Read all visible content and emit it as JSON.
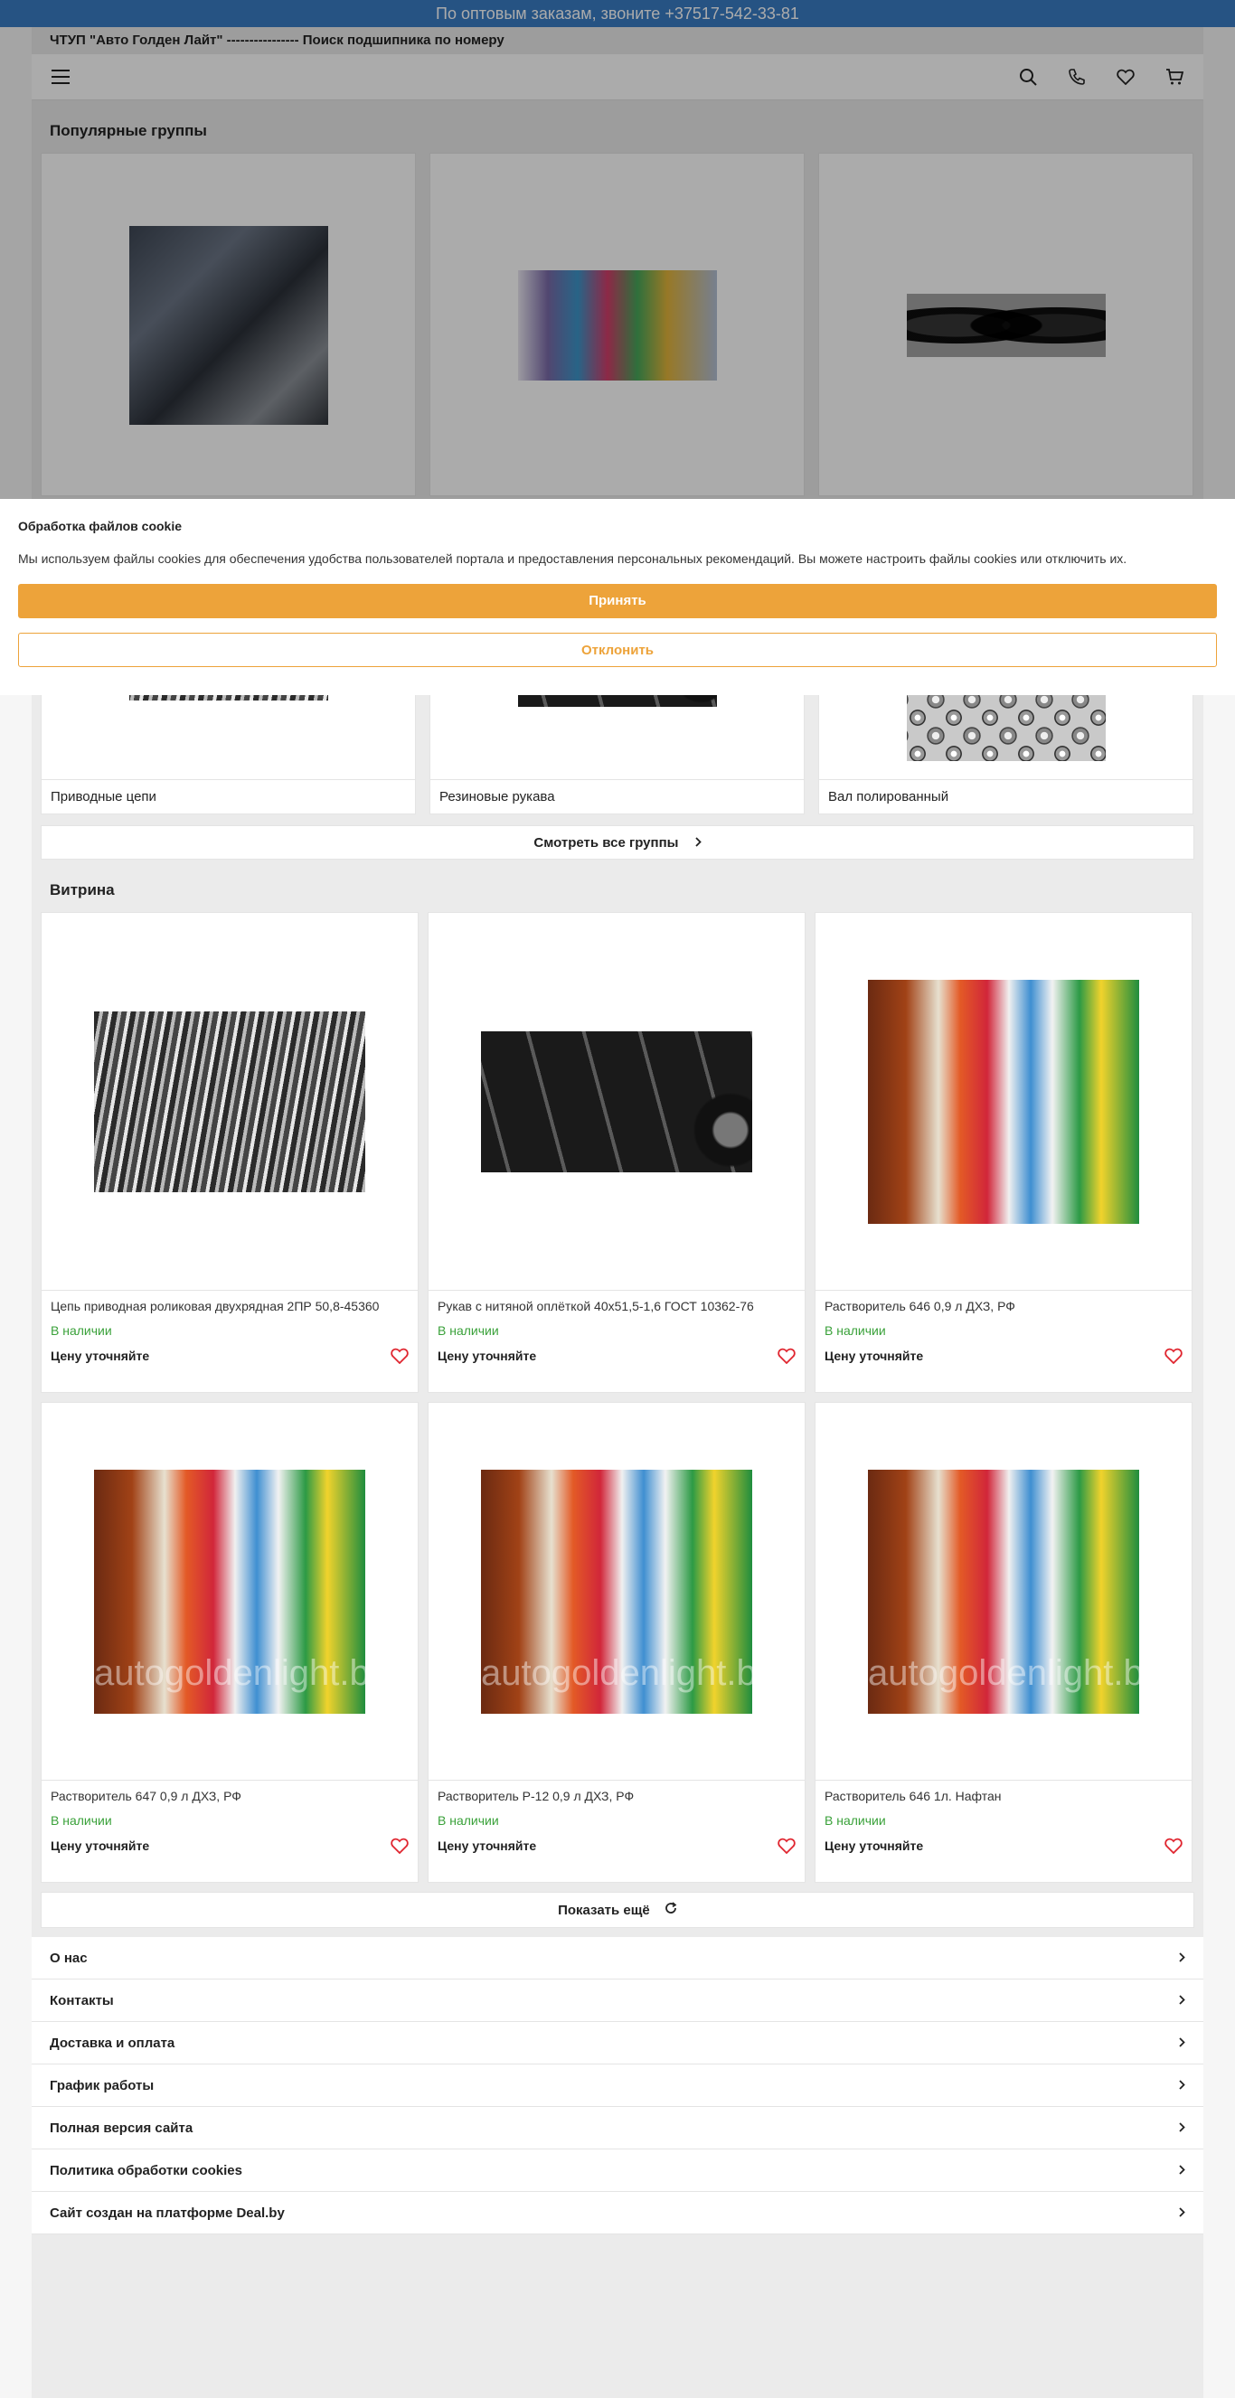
{
  "top_banner": {
    "text": "По оптовым заказам, звоните +37517-542-33-81"
  },
  "subheader": {
    "text": "ЧТУП \"Авто Голден Лайт\" ---------------- Поиск подшипника по номеру"
  },
  "navbar": {
    "icons": [
      "menu-icon",
      "search-icon",
      "phone-icon",
      "heart-icon",
      "cart-icon"
    ]
  },
  "groups": {
    "title": "Популярные группы",
    "row2": [
      {
        "label": "Приводные цепи",
        "image": "chains"
      },
      {
        "label": "Резиновые рукава",
        "image": "hoses"
      },
      {
        "label": "Вал полированный",
        "image": "steel-balls"
      }
    ],
    "all_groups_label": "Смотреть все группы"
  },
  "showcase": {
    "title": "Витрина",
    "products": [
      {
        "name": "Цепь приводная роликовая двухрядная 2ПР 50,8-45360",
        "stock": "В наличии",
        "price": "Цену уточняйте"
      },
      {
        "name": "Рукав с нитяной оплёткой 40х51,5-1,6 ГОСТ 10362-76",
        "stock": "В наличии",
        "price": "Цену уточняйте"
      },
      {
        "name": "Растворитель 646 0,9 л ДХЗ, РФ",
        "stock": "В наличии",
        "price": "Цену уточняйте"
      },
      {
        "name": "Растворитель 647 0,9 л ДХЗ, РФ",
        "stock": "В наличии",
        "price": "Цену уточняйте"
      },
      {
        "name": "Растворитель Р-12 0,9 л ДХЗ, РФ",
        "stock": "В наличии",
        "price": "Цену уточняйте"
      },
      {
        "name": "Растворитель 646 1л. Нафтан",
        "stock": "В наличии",
        "price": "Цену уточняйте"
      }
    ],
    "watermark": "autogoldenlight.by",
    "show_more_label": "Показать ещё"
  },
  "footer_links": [
    {
      "label": "О нас"
    },
    {
      "label": "Контакты"
    },
    {
      "label": "Доставка и оплата"
    },
    {
      "label": "График работы"
    },
    {
      "label": "Полная версия сайта"
    },
    {
      "label": "Политика обработки cookies"
    },
    {
      "label": "Сайт создан на платформе Deal.by"
    }
  ],
  "cookie": {
    "title": "Обработка файлов cookie",
    "text": "Мы используем файлы cookies для обеспечения удобства пользователей портала и предоставления персональных рекомендаций. Вы можете настроить файлы cookies или отключить их.",
    "accept_label": "Принять",
    "decline_label": "Отклонить"
  },
  "colors": {
    "banner": "#3a7cc4",
    "accent": "#eda33a",
    "stock": "#3aa13a",
    "heart": "#e0252f"
  }
}
